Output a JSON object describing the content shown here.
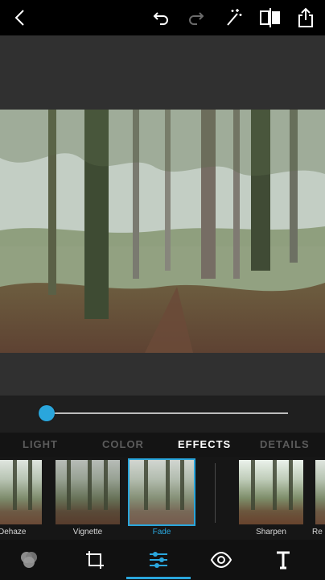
{
  "toolbar": {
    "back_icon": "chevron-left-icon",
    "undo_icon": "undo-icon",
    "redo_icon": "redo-icon",
    "auto_fix_icon": "magic-wand-icon",
    "compare_icon": "compare-icon",
    "share_icon": "share-icon"
  },
  "adjustment_slider": {
    "value_fraction": 0.0,
    "accent_color": "#2aa6dc"
  },
  "tabs": [
    {
      "label": "LIGHT",
      "active": false
    },
    {
      "label": "COLOR",
      "active": false
    },
    {
      "label": "EFFECTS",
      "active": true
    },
    {
      "label": "DETAILS",
      "active": false
    }
  ],
  "effects": [
    {
      "label": "Dehaze",
      "selected": false
    },
    {
      "label": "Vignette",
      "selected": false
    },
    {
      "label": "Fade",
      "selected": true
    },
    {
      "label": "Sharpen",
      "selected": false
    },
    {
      "label": "Re",
      "selected": false
    }
  ],
  "bottom_nav": [
    {
      "name": "looks-icon",
      "active": false
    },
    {
      "name": "crop-icon",
      "active": false
    },
    {
      "name": "adjustments-icon",
      "active": true
    },
    {
      "name": "red-eye-icon",
      "active": false
    },
    {
      "name": "text-icon",
      "active": false
    }
  ]
}
